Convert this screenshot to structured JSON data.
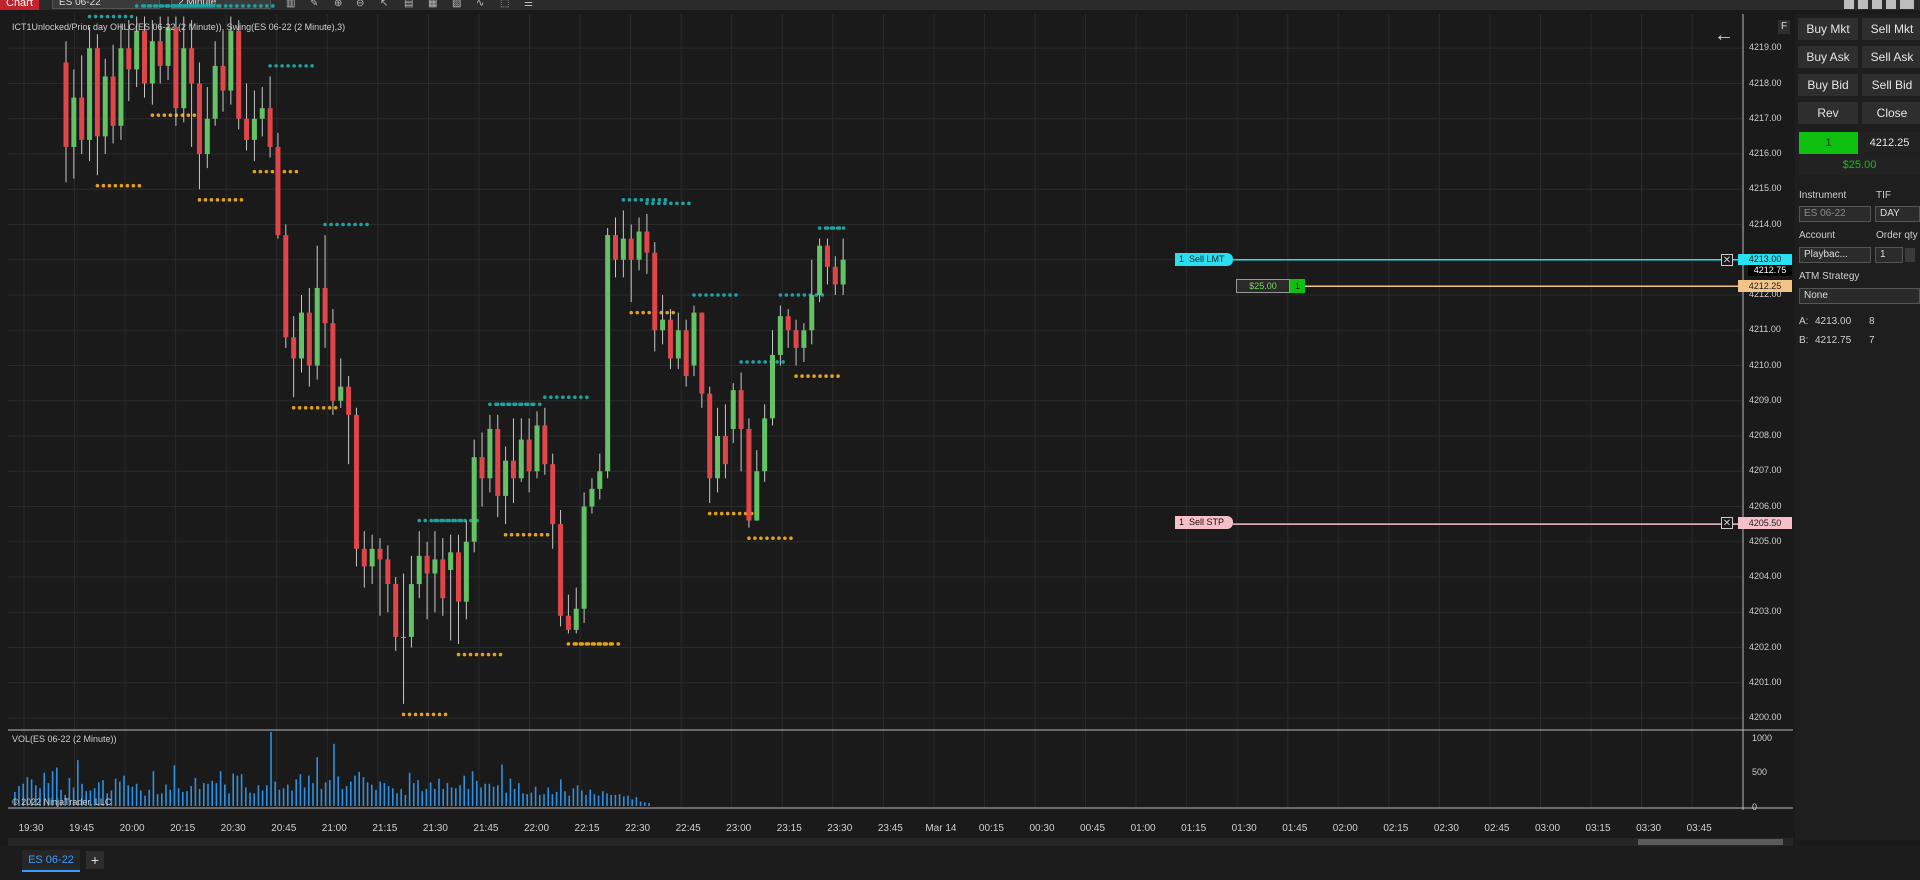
{
  "toolbar": {
    "title": "Chart",
    "instrument": "ES 06-22",
    "interval": "2 Minute"
  },
  "chart": {
    "indicator_label": "ICT1Unlocked/Prior day OHLC(ES 06-22 (2 Minute)), Swing(ES 06-22 (2 Minute),3)",
    "volume_label": "VOL(ES 06-22 (2 Minute))",
    "copyright": "© 2022 NinjaTrader, LLC",
    "price_ticks": [
      "4219.00",
      "4218.00",
      "4217.00",
      "4216.00",
      "4215.00",
      "4214.00",
      "4213.00",
      "4212.00",
      "4211.00",
      "4210.00",
      "4209.00",
      "4208.00",
      "4207.00",
      "4206.00",
      "4205.00",
      "4204.00",
      "4203.00",
      "4202.00",
      "4201.00",
      "4200.00"
    ],
    "volume_ticks": [
      "1000",
      "500",
      "0"
    ],
    "time_ticks": [
      "19:30",
      "19:45",
      "20:00",
      "20:15",
      "20:30",
      "20:45",
      "21:00",
      "21:15",
      "21:30",
      "21:45",
      "22:00",
      "22:15",
      "22:30",
      "22:45",
      "23:00",
      "23:15",
      "23:30",
      "23:45",
      "Mar 14",
      "00:15",
      "00:30",
      "00:45",
      "01:00",
      "01:15",
      "01:30",
      "01:45",
      "02:00",
      "02:15",
      "02:30",
      "02:45",
      "03:00",
      "03:15",
      "03:30",
      "03:45"
    ],
    "ask_price_label": "4212.75",
    "last_price_label": "4212.25",
    "sell_limit": {
      "qty": "1",
      "label": "Sell LMT",
      "price": "4213.00"
    },
    "position": {
      "pnl": "$25.00",
      "qty": "1",
      "price": "4212.25"
    },
    "sell_stop": {
      "qty": "1",
      "label": "Sell STP",
      "price": "4205.50"
    },
    "candles": [
      [
        4218.6,
        4216.2,
        4219.2,
        4215.2
      ],
      [
        4216.2,
        4217.6,
        4218.4,
        4215.3
      ],
      [
        4217.6,
        4216.4,
        4218.8,
        4216.0
      ],
      [
        4216.4,
        4219.0,
        4219.6,
        4215.8
      ],
      [
        4219.0,
        4216.5,
        4219.4,
        4215.4
      ],
      [
        4216.5,
        4218.2,
        4218.7,
        4216.0
      ],
      [
        4218.2,
        4216.8,
        4219.1,
        4216.3
      ],
      [
        4216.8,
        4219.0,
        4219.7,
        4216.4
      ],
      [
        4219.0,
        4218.4,
        4219.8,
        4217.5
      ],
      [
        4218.4,
        4219.5,
        4219.9,
        4217.9
      ],
      [
        4219.5,
        4218.0,
        4219.9,
        4217.6
      ],
      [
        4218.0,
        4219.2,
        4219.8,
        4217.4
      ],
      [
        4219.2,
        4218.5,
        4219.9,
        4218.0
      ],
      [
        4218.5,
        4219.6,
        4219.9,
        4218.1
      ],
      [
        4219.6,
        4217.3,
        4219.9,
        4216.8
      ],
      [
        4217.3,
        4219.0,
        4219.9,
        4216.9
      ],
      [
        4219.0,
        4218.0,
        4219.8,
        4216.2
      ],
      [
        4218.0,
        4216.0,
        4218.6,
        4215.0
      ],
      [
        4216.0,
        4217.0,
        4217.9,
        4215.6
      ],
      [
        4217.0,
        4218.5,
        4219.2,
        4216.8
      ],
      [
        4218.5,
        4217.8,
        4219.5,
        4217.2
      ],
      [
        4217.8,
        4219.5,
        4219.9,
        4217.4
      ],
      [
        4219.5,
        4217.0,
        4219.8,
        4216.7
      ],
      [
        4217.0,
        4216.4,
        4218.0,
        4216.1
      ],
      [
        4216.4,
        4217.0,
        4217.8,
        4215.8
      ],
      [
        4217.0,
        4217.3,
        4217.9,
        4216.5
      ],
      [
        4217.3,
        4216.2,
        4218.2,
        4215.9
      ],
      [
        4216.2,
        4213.7,
        4216.6,
        4213.6
      ],
      [
        4213.7,
        4210.8,
        4214.0,
        4210.5
      ],
      [
        4210.8,
        4210.2,
        4211.4,
        4209.1
      ],
      [
        4210.2,
        4211.5,
        4212.0,
        4209.8
      ],
      [
        4211.5,
        4210.0,
        4212.2,
        4209.4
      ],
      [
        4210.0,
        4212.2,
        4213.4,
        4209.6
      ],
      [
        4212.2,
        4211.2,
        4213.7,
        4210.5
      ],
      [
        4211.2,
        4209.0,
        4211.6,
        4208.6
      ],
      [
        4209.0,
        4209.4,
        4210.2,
        4208.8
      ],
      [
        4209.4,
        4208.6,
        4209.7,
        4207.2
      ],
      [
        4208.6,
        4204.8,
        4208.8,
        4204.3
      ],
      [
        4204.8,
        4204.3,
        4205.3,
        4203.7
      ],
      [
        4204.3,
        4204.8,
        4205.2,
        4203.8
      ],
      [
        4204.8,
        4204.5,
        4205.1,
        4202.9
      ],
      [
        4204.5,
        4203.8,
        4204.9,
        4203.0
      ],
      [
        4203.8,
        4202.3,
        4204.0,
        4201.9
      ],
      [
        4202.3,
        4202.3,
        4204.1,
        4200.4
      ],
      [
        4202.3,
        4203.8,
        4204.6,
        4202.0
      ],
      [
        4203.8,
        4204.6,
        4205.3,
        4203.4
      ],
      [
        4204.6,
        4204.1,
        4205.0,
        4202.8
      ],
      [
        4204.1,
        4204.5,
        4205.3,
        4203.0
      ],
      [
        4204.5,
        4203.4,
        4205.1,
        4202.9
      ],
      [
        4204.2,
        4204.7,
        4205.2,
        4202.2
      ],
      [
        4204.7,
        4203.3,
        4205.2,
        4202.1
      ],
      [
        4203.3,
        4205.0,
        4205.6,
        4202.8
      ],
      [
        4205.0,
        4207.4,
        4207.9,
        4204.7
      ],
      [
        4207.4,
        4206.8,
        4208.1,
        4206.0
      ],
      [
        4206.8,
        4208.2,
        4208.6,
        4206.4
      ],
      [
        4208.2,
        4206.3,
        4208.6,
        4205.7
      ],
      [
        4206.3,
        4207.3,
        4207.7,
        4205.5
      ],
      [
        4207.3,
        4206.8,
        4208.5,
        4206.1
      ],
      [
        4206.8,
        4207.9,
        4208.5,
        4206.7
      ],
      [
        4207.9,
        4207.0,
        4208.5,
        4206.4
      ],
      [
        4207.0,
        4208.3,
        4208.7,
        4206.8
      ],
      [
        4208.3,
        4207.2,
        4208.8,
        4206.9
      ],
      [
        4207.2,
        4205.5,
        4207.5,
        4204.8
      ],
      [
        4205.5,
        4202.9,
        4205.9,
        4202.6
      ],
      [
        4202.9,
        4202.5,
        4203.5,
        4202.4
      ],
      [
        4202.5,
        4203.1,
        4203.7,
        4202.4
      ],
      [
        4203.1,
        4206.0,
        4206.4,
        4202.7
      ],
      [
        4206.0,
        4206.5,
        4206.8,
        4205.8
      ],
      [
        4206.5,
        4207.0,
        4207.5,
        4206.2
      ],
      [
        4207.0,
        4213.7,
        4213.9,
        4206.8
      ],
      [
        4213.7,
        4213.0,
        4214.2,
        4212.5
      ],
      [
        4213.0,
        4213.6,
        4214.4,
        4212.5
      ],
      [
        4213.6,
        4213.0,
        4214.0,
        4211.8
      ],
      [
        4213.0,
        4213.8,
        4214.2,
        4212.7
      ],
      [
        4213.8,
        4213.2,
        4214.3,
        4212.6
      ],
      [
        4213.2,
        4211.0,
        4213.5,
        4210.4
      ],
      [
        4211.0,
        4211.3,
        4212.0,
        4210.6
      ],
      [
        4211.3,
        4210.2,
        4211.6,
        4209.9
      ],
      [
        4210.2,
        4211.0,
        4211.5,
        4209.9
      ],
      [
        4211.0,
        4209.7,
        4211.3,
        4209.4
      ],
      [
        4210.0,
        4211.5,
        4211.7,
        4209.7
      ],
      [
        4211.5,
        4209.2,
        4211.5,
        4208.8
      ],
      [
        4209.2,
        4206.8,
        4209.4,
        4206.1
      ],
      [
        4206.8,
        4208.0,
        4208.8,
        4206.4
      ],
      [
        4208.0,
        4207.2,
        4208.9,
        4206.8
      ],
      [
        4208.2,
        4209.3,
        4209.5,
        4207.8
      ],
      [
        4209.3,
        4208.2,
        4209.8,
        4207.0
      ],
      [
        4208.2,
        4205.6,
        4208.5,
        4205.4
      ],
      [
        4205.6,
        4207.0,
        4207.6,
        4205.6
      ],
      [
        4207.0,
        4208.5,
        4208.9,
        4206.7
      ],
      [
        4208.5,
        4210.3,
        4211.0,
        4208.3
      ],
      [
        4210.3,
        4211.4,
        4211.7,
        4210.0
      ],
      [
        4211.4,
        4211.0,
        4211.6,
        4210.5
      ],
      [
        4211.0,
        4210.5,
        4211.3,
        4210.0
      ],
      [
        4210.5,
        4211.0,
        4211.2,
        4210.1
      ],
      [
        4211.0,
        4212.0,
        4213.0,
        4210.6
      ],
      [
        4212.0,
        4213.4,
        4213.6,
        4211.8
      ],
      [
        4213.4,
        4212.8,
        4213.6,
        4212.3
      ],
      [
        4212.8,
        4212.3,
        4213.1,
        4212.0
      ],
      [
        4212.3,
        4213.0,
        4213.6,
        4212.0
      ]
    ],
    "volumes": [
      190,
      270,
      300,
      390,
      360,
      280,
      240,
      450,
      310,
      470,
      520,
      220,
      150,
      380,
      250,
      620,
      300,
      200,
      210,
      240,
      320,
      350,
      170,
      210,
      370,
      330,
      410,
      280,
      260,
      300,
      210,
      140,
      220,
      470,
      160,
      170,
      290,
      220,
      550,
      240,
      190,
      200,
      270,
      380,
      230,
      310,
      300,
      340,
      310,
      470,
      290,
      170,
      440,
      410,
      430,
      250,
      180,
      170,
      280,
      210,
      280,
      1000,
      330,
      220,
      240,
      290,
      210,
      360,
      430,
      250,
      410,
      310,
      660,
      230,
      320,
      350,
      840,
      400,
      230,
      270,
      330,
      410,
      460,
      390,
      320,
      290,
      220,
      330,
      310,
      270,
      240,
      170,
      230,
      150,
      450,
      310,
      350,
      200,
      230,
      320,
      230,
      370,
      230,
      310,
      250,
      240,
      280,
      410,
      230,
      470,
      340,
      250,
      300,
      300,
      260,
      280,
      560,
      180,
      370,
      230,
      310,
      170,
      160,
      180,
      260,
      150,
      160,
      250,
      160,
      190,
      360,
      200,
      140,
      240,
      280,
      210,
      150,
      220,
      160,
      140,
      200,
      170,
      150,
      150,
      160,
      130,
      140,
      90,
      120,
      60,
      50,
      40
    ]
  },
  "panel": {
    "buy_mkt": "Buy Mkt",
    "sell_mkt": "Sell Mkt",
    "buy_ask": "Buy Ask",
    "sell_ask": "Sell Ask",
    "buy_bid": "Buy Bid",
    "sell_bid": "Sell Bid",
    "rev": "Rev",
    "close": "Close",
    "position_qty": "1",
    "position_price": "4212.25",
    "pnl": "$25.00",
    "f_label": "F",
    "instrument_label": "Instrument",
    "instrument_value": "ES 06-22",
    "tif_label": "TIF",
    "tif_value": "DAY",
    "account_label": "Account",
    "account_value": "Playbac...",
    "order_qty_label": "Order qty",
    "order_qty_value": "1",
    "atm_label": "ATM Strategy",
    "atm_value": "None",
    "ask_label": "A:",
    "ask_price": "4213.00",
    "ask_size": "8",
    "bid_label": "B:",
    "bid_price": "4212.75",
    "bid_size": "7"
  },
  "tabs": {
    "active": "ES 06-22",
    "add": "+"
  },
  "colors": {
    "up": "#62c265",
    "down": "#e0454a",
    "swing_high": "#1aa3a3",
    "swing_low": "#e3a21a",
    "volume": "#2f8fe0",
    "limit": "#29e0f0",
    "stop": "#f6c0c8",
    "position": "#f2c48a",
    "panel_green": "#10c010"
  }
}
